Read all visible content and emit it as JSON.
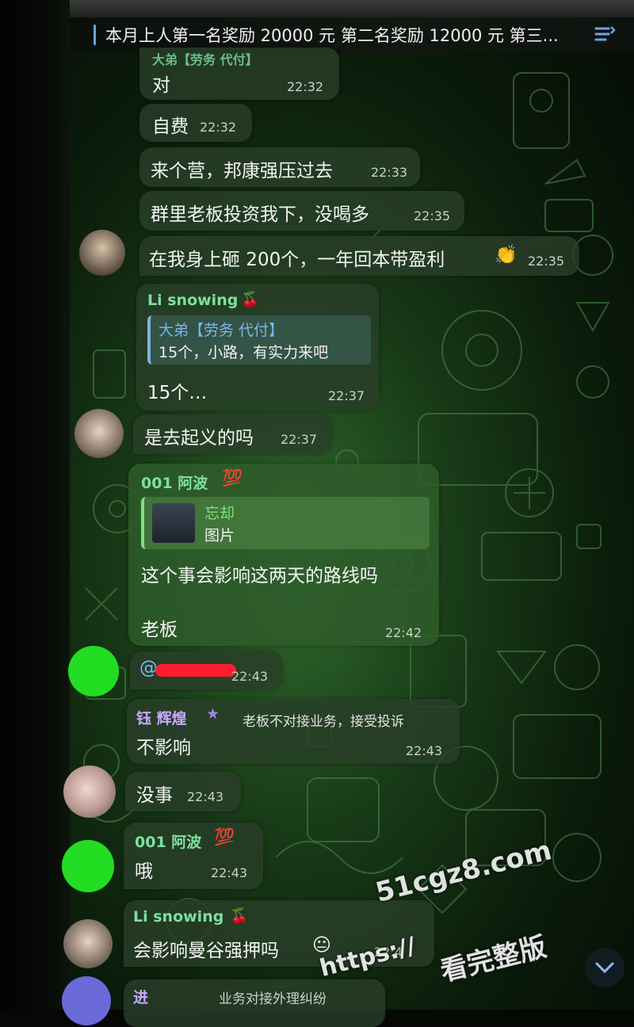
{
  "pinned": {
    "text": "本月上人第一名奖励 20000 元 第二名奖励 12000 元 第三..."
  },
  "messages": {
    "m1": {
      "partial_header": "大弟【劳务 代付】",
      "text": "对",
      "time": "22:32"
    },
    "m2": {
      "text": "自费",
      "time": "22:32"
    },
    "m3": {
      "text": "来个营，邦康强压过去",
      "time": "22:33"
    },
    "m4": {
      "text": "群里老板投资我下，没喝多",
      "time": "22:35"
    },
    "m5": {
      "text": "在我身上砸 200个，一年回本带盈利",
      "emoji": "👏",
      "time": "22:35"
    },
    "m6": {
      "sender": "Li snowing",
      "sender_emoji": "🍒",
      "reply_name": "大弟【劳务 代付】",
      "reply_text": "15个，小路，有实力来吧",
      "text": "15个…",
      "time": "22:37"
    },
    "m7": {
      "text": "是去起义的吗",
      "time": "22:37"
    },
    "m8": {
      "sender": "001 阿波",
      "sender_badge": "💯",
      "reply_name": "忘却",
      "reply_text": "图片",
      "text": "这个事会影响这两天的路线吗",
      "text2": "老板",
      "time": "22:42"
    },
    "m9": {
      "text": "@",
      "time": "22:43"
    },
    "m10": {
      "sender": "钰 辉煌",
      "sender_badge": "★",
      "sender_title": "老板不对接业务，接受投诉",
      "text": "不影响",
      "time": "22:43"
    },
    "m11": {
      "text": "没事",
      "time": "22:43"
    },
    "m12": {
      "sender": "001 阿波",
      "sender_badge": "💯",
      "text": "哦",
      "time": "22:43"
    },
    "m13": {
      "sender": "Li snowing",
      "sender_emoji": "🍒",
      "text": "会影响曼谷强押吗",
      "emoji": "😐",
      "time": "22:4"
    },
    "m14": {
      "partial_sender": "进",
      "partial_title": "业务对接外理纠纷"
    }
  },
  "watermark": {
    "line1": "51cgz8.com",
    "line2": "https://",
    "line3": "看完整版"
  },
  "colors": {
    "sender_green": "#7de0a0",
    "sender_purple": "#c9a8ff",
    "reply_blue": "#79b6f0",
    "reply_green": "#7fe07f",
    "avatar_green": "#22dd22"
  }
}
